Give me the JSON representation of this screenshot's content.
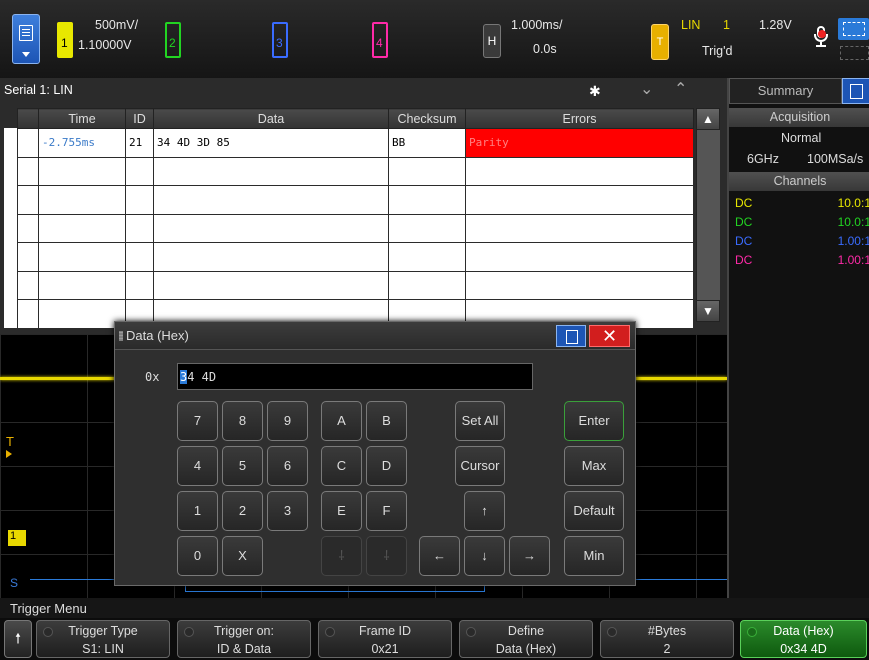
{
  "topbar": {
    "ch1": {
      "num": "1",
      "scale": "500mV/",
      "offset": "1.10000V"
    },
    "ch2": {
      "num": "2"
    },
    "ch3": {
      "num": "3"
    },
    "ch4": {
      "num": "4"
    },
    "horizontal": {
      "label": "H",
      "scale": "1.000ms/",
      "delay": "0.0s"
    },
    "trigger": {
      "label": "T",
      "type": "LIN",
      "source": "1",
      "level": "1.28V",
      "status": "Trig'd"
    }
  },
  "serial": {
    "title": "Serial 1: LIN",
    "columns": [
      "Time",
      "ID",
      "Data",
      "Checksum",
      "Errors"
    ],
    "rows": [
      {
        "time": "-2.755ms",
        "id": "21",
        "data": "34 4D 3D 85",
        "checksum": "BB",
        "errors": "Parity"
      },
      {
        "time": "",
        "id": "",
        "data": "",
        "checksum": "",
        "errors": ""
      },
      {
        "time": "",
        "id": "",
        "data": "",
        "checksum": "",
        "errors": ""
      },
      {
        "time": "",
        "id": "",
        "data": "",
        "checksum": "",
        "errors": ""
      },
      {
        "time": "",
        "id": "",
        "data": "",
        "checksum": "",
        "errors": ""
      },
      {
        "time": "",
        "id": "",
        "data": "",
        "checksum": "",
        "errors": ""
      },
      {
        "time": "",
        "id": "",
        "data": "",
        "checksum": "",
        "errors": ""
      },
      {
        "time": "",
        "id": "",
        "data": "",
        "checksum": "",
        "errors": ""
      }
    ]
  },
  "waveform": {
    "trigger_marker": "T",
    "ch1_marker": "1",
    "serial_marker": "S"
  },
  "right_panel": {
    "tab_summary": "Summary",
    "acquisition_header": "Acquisition",
    "acq_mode": "Normal",
    "sample_rate_max": "6GHz",
    "sample_rate": "100MSa/s",
    "channels_header": "Channels",
    "channels": [
      {
        "coupling": "DC",
        "probe": "10.0:1",
        "color": "#e8e800"
      },
      {
        "coupling": "DC",
        "probe": "10.0:1",
        "color": "#22d422"
      },
      {
        "coupling": "DC",
        "probe": "1.00:1",
        "color": "#3a6cff"
      },
      {
        "coupling": "DC",
        "probe": "1.00:1",
        "color": "#ff2aa8"
      }
    ]
  },
  "dialog": {
    "title": "Data (Hex)",
    "prefix": "0x",
    "cursor_char": "3",
    "value_rest": "4 4D",
    "keys": {
      "k7": "7",
      "k8": "8",
      "k9": "9",
      "kA": "A",
      "kB": "B",
      "k4": "4",
      "k5": "5",
      "k6": "6",
      "kC": "C",
      "kD": "D",
      "k1": "1",
      "k2": "2",
      "k3": "3",
      "kE": "E",
      "kF": "F",
      "k0": "0",
      "kX": "X",
      "set_all": "Set All",
      "cursor": "Cursor",
      "up": "↑",
      "left": "←",
      "down": "↓",
      "right": "→",
      "enter": "Enter",
      "max": "Max",
      "default": "Default",
      "min": "Min"
    }
  },
  "menu": {
    "title": "Trigger Menu",
    "softkeys": [
      {
        "label": "Trigger Type",
        "value": "S1: LIN"
      },
      {
        "label": "Trigger on:",
        "value": "ID & Data"
      },
      {
        "label": "Frame ID",
        "value": "0x21"
      },
      {
        "label": "Define",
        "value": "Data (Hex)"
      },
      {
        "label": "#Bytes",
        "value": "2"
      },
      {
        "label": "Data (Hex)",
        "value": "0x34 4D"
      }
    ]
  }
}
